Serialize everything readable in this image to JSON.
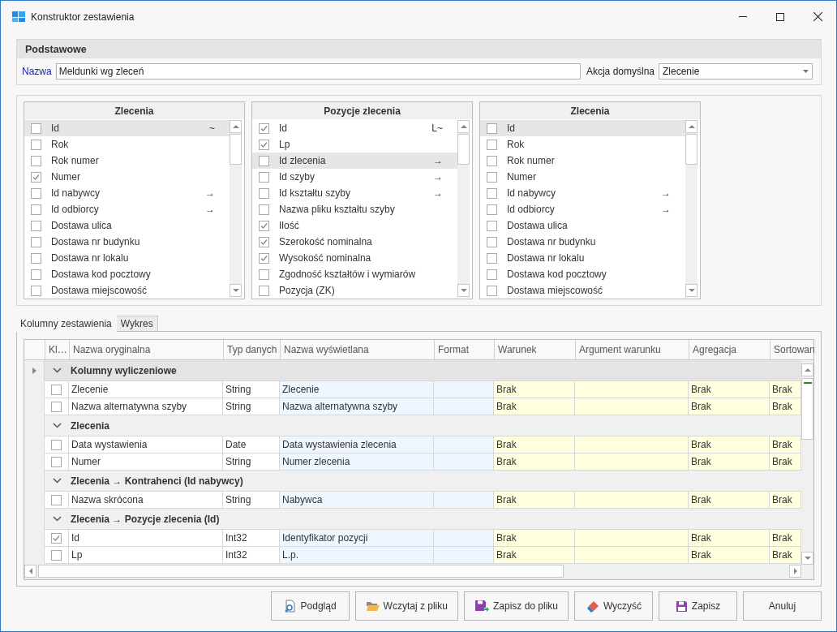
{
  "window": {
    "title": "Konstruktor zestawienia"
  },
  "basic": {
    "title": "Podstawowe",
    "name_label": "Nazwa",
    "name_value": "Meldunki wg zleceń",
    "action_label": "Akcja domyślna",
    "action_value": "Zlecenie"
  },
  "field_lists": [
    {
      "title": "Zlecenia",
      "fields": [
        {
          "label": "Id",
          "checked": false,
          "selected": true,
          "marker": "~"
        },
        {
          "label": "Rok",
          "checked": false,
          "selected": false
        },
        {
          "label": "Rok numer",
          "checked": false,
          "selected": false
        },
        {
          "label": "Numer",
          "checked": true,
          "selected": false
        },
        {
          "label": "Id nabywcy",
          "checked": false,
          "selected": false,
          "marker": "→"
        },
        {
          "label": "Id odbiorcy",
          "checked": false,
          "selected": false,
          "marker": "→"
        },
        {
          "label": "Dostawa ulica",
          "checked": false,
          "selected": false
        },
        {
          "label": "Dostawa nr budynku",
          "checked": false,
          "selected": false
        },
        {
          "label": "Dostawa nr lokalu",
          "checked": false,
          "selected": false
        },
        {
          "label": "Dostawa kod pocztowy",
          "checked": false,
          "selected": false
        },
        {
          "label": "Dostawa miejscowość",
          "checked": false,
          "selected": false
        }
      ]
    },
    {
      "title": "Pozycje zlecenia",
      "fields": [
        {
          "label": "Id",
          "checked": true,
          "selected": false,
          "marker": "L~"
        },
        {
          "label": "Lp",
          "checked": true,
          "selected": false
        },
        {
          "label": "Id zlecenia",
          "checked": false,
          "selected": true,
          "marker": "→"
        },
        {
          "label": "Id szyby",
          "checked": false,
          "selected": false,
          "marker": "→"
        },
        {
          "label": "Id kształtu szyby",
          "checked": false,
          "selected": false,
          "marker": "→"
        },
        {
          "label": "Nazwa pliku kształtu szyby",
          "checked": false,
          "selected": false
        },
        {
          "label": "Ilość",
          "checked": true,
          "selected": false
        },
        {
          "label": "Szerokość nominalna",
          "checked": true,
          "selected": false
        },
        {
          "label": "Wysokość nominalna",
          "checked": true,
          "selected": false
        },
        {
          "label": "Zgodność kształtów i wymiarów",
          "checked": false,
          "selected": false
        },
        {
          "label": "Pozycja (ZK)",
          "checked": false,
          "selected": false
        }
      ]
    },
    {
      "title": "Zlecenia",
      "fields": [
        {
          "label": "Id",
          "checked": false,
          "selected": true
        },
        {
          "label": "Rok",
          "checked": false,
          "selected": false
        },
        {
          "label": "Rok numer",
          "checked": false,
          "selected": false
        },
        {
          "label": "Numer",
          "checked": false,
          "selected": false
        },
        {
          "label": "Id nabywcy",
          "checked": false,
          "selected": false,
          "marker": "→"
        },
        {
          "label": "Id odbiorcy",
          "checked": false,
          "selected": false,
          "marker": "→"
        },
        {
          "label": "Dostawa ulica",
          "checked": false,
          "selected": false
        },
        {
          "label": "Dostawa nr budynku",
          "checked": false,
          "selected": false
        },
        {
          "label": "Dostawa nr lokalu",
          "checked": false,
          "selected": false
        },
        {
          "label": "Dostawa kod pocztowy",
          "checked": false,
          "selected": false
        },
        {
          "label": "Dostawa miejscowość",
          "checked": false,
          "selected": false
        }
      ]
    }
  ],
  "tabs": [
    {
      "label": "Kolumny zestawienia",
      "selected": true
    },
    {
      "label": "Wykres",
      "selected": false
    }
  ],
  "grid": {
    "columns": [
      "Kl…",
      "Nazwa oryginalna",
      "Typ danych",
      "Nazwa wyświetlana",
      "Format",
      "Warunek",
      "Argument warunku",
      "Agregacja",
      "Sortowan"
    ],
    "groups": [
      {
        "title": "Kolumny wyliczeniowe",
        "current": true,
        "expanded": true,
        "rows": [
          {
            "checked": false,
            "cells": {
              "original": "Zlecenie",
              "type": "String",
              "display": "Zlecenie",
              "condition": "Brak",
              "aggregation": "Brak",
              "sorting": "Brak"
            }
          },
          {
            "checked": false,
            "cells": {
              "original": "Nazwa alternatywna szyby",
              "type": "String",
              "display": "Nazwa alternatywna szyby",
              "condition": "Brak",
              "aggregation": "Brak",
              "sorting": "Brak"
            }
          }
        ]
      },
      {
        "title": "Zlecenia",
        "current": false,
        "expanded": true,
        "rows": [
          {
            "checked": false,
            "cells": {
              "original": "Data wystawienia",
              "type": "Date",
              "display": "Data wystawienia zlecenia",
              "condition": "Brak",
              "aggregation": "Brak",
              "sorting": "Brak"
            }
          },
          {
            "checked": false,
            "cells": {
              "original": "Numer",
              "type": "String",
              "display": "Numer zlecenia",
              "condition": "Brak",
              "aggregation": "Brak",
              "sorting": "Brak"
            }
          }
        ]
      },
      {
        "title": "Zlecenia → Kontrahenci (Id nabywcy)",
        "current": false,
        "expanded": true,
        "rows": [
          {
            "checked": false,
            "cells": {
              "original": "Nazwa skrócona",
              "type": "String",
              "display": "Nabywca",
              "condition": "Brak",
              "aggregation": "Brak",
              "sorting": "Brak"
            }
          }
        ]
      },
      {
        "title": "Zlecenia → Pozycje zlecenia (Id)",
        "current": false,
        "expanded": true,
        "rows": [
          {
            "checked": true,
            "cells": {
              "original": "Id",
              "type": "Int32",
              "display": "Identyfikator pozycji",
              "condition": "Brak",
              "aggregation": "Brak",
              "sorting": "Brak"
            }
          },
          {
            "checked": false,
            "cells": {
              "original": "Lp",
              "type": "Int32",
              "display": "L.p.",
              "condition": "Brak",
              "aggregation": "Brak",
              "sorting": "Brak"
            }
          }
        ]
      }
    ]
  },
  "buttons": [
    "Podgląd",
    "Wczytaj z pliku",
    "Zapisz do pliku",
    "Wyczyść",
    "Zapisz",
    "Anuluj"
  ]
}
